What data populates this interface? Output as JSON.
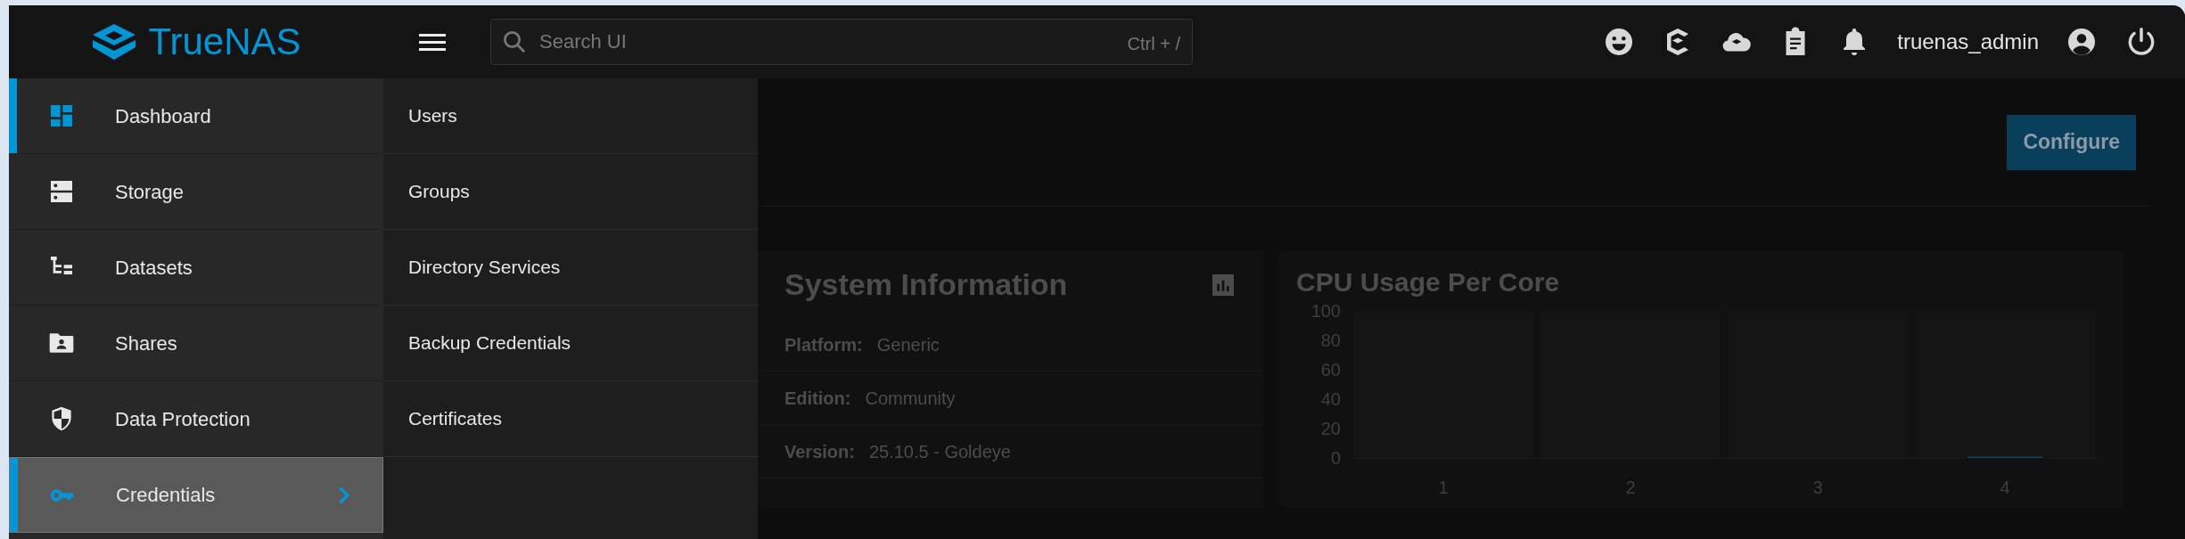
{
  "topbar": {
    "brand": "TrueNAS",
    "search": {
      "placeholder": "Search UI",
      "shortcut": "Ctrl + /"
    },
    "username": "truenas_admin"
  },
  "sidebar": {
    "items": [
      {
        "label": "Dashboard",
        "current": true,
        "expanded": false
      },
      {
        "label": "Storage",
        "current": false,
        "expanded": false
      },
      {
        "label": "Datasets",
        "current": false,
        "expanded": false
      },
      {
        "label": "Shares",
        "current": false,
        "expanded": false
      },
      {
        "label": "Data Protection",
        "current": false,
        "expanded": false
      },
      {
        "label": "Credentials",
        "current": false,
        "expanded": true
      }
    ]
  },
  "submenu": {
    "items": [
      "Users",
      "Groups",
      "Directory Services",
      "Backup Credentials",
      "Certificates"
    ]
  },
  "main": {
    "configure_button": "Configure",
    "system_info": {
      "title": "System Information",
      "rows": [
        {
          "label": "Platform:",
          "value": "Generic"
        },
        {
          "label": "Edition:",
          "value": "Community"
        },
        {
          "label": "Version:",
          "value": "25.10.5 - Goldeye"
        }
      ]
    },
    "cpu": {
      "title": "CPU Usage Per Core",
      "chart_data": {
        "type": "bar",
        "categories": [
          "1",
          "2",
          "3",
          "4"
        ],
        "series": [
          {
            "color": "#0095d5",
            "values": [
              0,
              0,
              0,
              1
            ]
          }
        ],
        "ylim": [
          0,
          100
        ],
        "yticks": [
          0,
          20,
          40,
          60,
          80,
          100
        ]
      }
    }
  }
}
